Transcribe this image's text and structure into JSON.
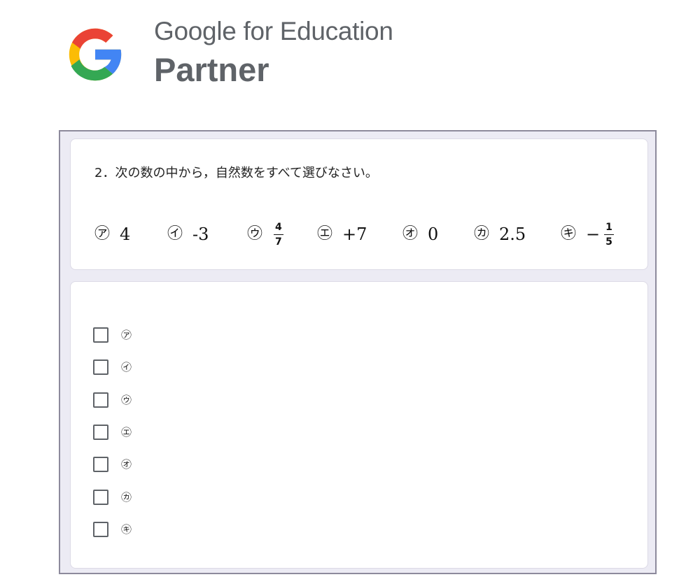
{
  "logo": {
    "line1": "Google for Education",
    "line2": "Partner",
    "colors": {
      "red": "#EA4335",
      "yellow": "#FBBC05",
      "green": "#34A853",
      "blue": "#4285F4"
    }
  },
  "question": {
    "text": "2．次の数の中から，自然数をすべて選びなさい。",
    "items": [
      {
        "mark": "㋐",
        "value": "4"
      },
      {
        "mark": "㋑",
        "value": "-3"
      },
      {
        "mark": "㋒",
        "numerator": "4",
        "denominator": "7"
      },
      {
        "mark": "㋓",
        "value": "+7"
      },
      {
        "mark": "㋔",
        "value": "0"
      },
      {
        "mark": "㋕",
        "value": "2.5"
      },
      {
        "mark": "㋖",
        "sign": "−",
        "numerator": "1",
        "denominator": "5"
      }
    ]
  },
  "answers": {
    "options": [
      "㋐",
      "㋑",
      "㋒",
      "㋓",
      "㋔",
      "㋕",
      "㋖"
    ]
  }
}
